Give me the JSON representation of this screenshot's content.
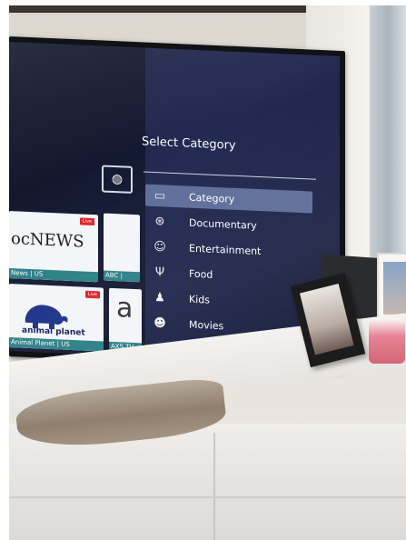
{
  "screen": {
    "panel_title": "Select Category",
    "menu": [
      {
        "label": "Category",
        "icon": "tv-icon",
        "active": true
      },
      {
        "label": "Documentary",
        "icon": "film-reel-icon",
        "active": false
      },
      {
        "label": "Entertainment",
        "icon": "theater-masks-icon",
        "active": false
      },
      {
        "label": "Food",
        "icon": "cutlery-icon",
        "active": false
      },
      {
        "label": "Kids",
        "icon": "children-icon",
        "active": false
      },
      {
        "label": "Movies",
        "icon": "movie-audience-icon",
        "active": false
      }
    ],
    "tiles": [
      {
        "logo": "ocNEWS",
        "caption": "News | US",
        "badge": "Live"
      },
      {
        "logo": "",
        "caption": "ABC |",
        "badge": ""
      },
      {
        "logo": "animal planet",
        "caption": "Animal Planet | US",
        "badge": "Live"
      },
      {
        "logo": "a",
        "caption": "AXS TV",
        "badge": ""
      }
    ],
    "accent_color": "#5f6e9a",
    "caption_color": "#2a7f86",
    "live_badge_color": "#d9232d"
  }
}
